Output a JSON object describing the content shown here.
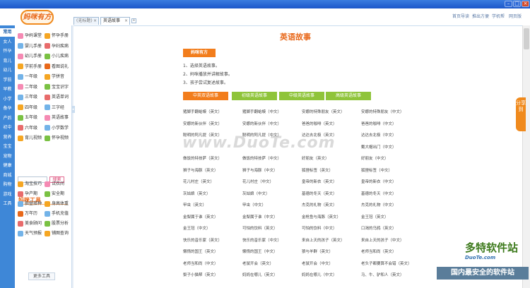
{
  "titlebar": {
    "min": "–",
    "max": "□",
    "close": "×"
  },
  "header": {
    "logo": "妈咪有方",
    "toplinks": [
      "首页导读",
      "推出方便",
      "学机帮",
      "网页版"
    ],
    "tabs": [
      {
        "label": "(无标题)",
        "close": "×"
      },
      {
        "label": "英语故事",
        "close": "×"
      }
    ],
    "tab_add": "+"
  },
  "leftnav": [
    "常用",
    "女人",
    "怀孕",
    "育儿",
    "幼儿",
    "学前",
    "早教",
    "小学",
    "备孕",
    "产后",
    "初中",
    "营养",
    "宝宝",
    "宠物",
    "健康",
    "商城",
    "购物",
    "游戏",
    "工具"
  ],
  "sidebar": {
    "items": [
      {
        "label": "孕妈课堂",
        "color": "#f58ab3"
      },
      {
        "label": "怀孕手册",
        "color": "#f5a623"
      },
      {
        "label": "婴儿手册",
        "color": "#73b3e8"
      },
      {
        "label": "孕妇疾病",
        "color": "#e86b6b"
      },
      {
        "label": "幼儿手册",
        "color": "#f58ab3"
      },
      {
        "label": "小儿疾病",
        "color": "#7ac143"
      },
      {
        "label": "学前手册",
        "color": "#f5a623"
      },
      {
        "label": "看图说礼",
        "color": "#e8681a"
      },
      {
        "label": "一年级",
        "color": "#73b3e8"
      },
      {
        "label": "学拼音",
        "color": "#f5a623"
      },
      {
        "label": "二年级",
        "color": "#f58ab3"
      },
      {
        "label": "宝宝识字",
        "color": "#7ac143"
      },
      {
        "label": "三年级",
        "color": "#73b3e8"
      },
      {
        "label": "英语单词",
        "color": "#e86b6b"
      },
      {
        "label": "四年级",
        "color": "#f5a623"
      },
      {
        "label": "三字经",
        "color": "#73b3e8"
      },
      {
        "label": "五年级",
        "color": "#7ac143"
      },
      {
        "label": "英语故事",
        "color": "#f58ab3"
      },
      {
        "label": "六年级",
        "color": "#e86b6b"
      },
      {
        "label": "小学数学",
        "color": "#73b3e8"
      },
      {
        "label": "育儿视频",
        "color": "#f5a623"
      },
      {
        "label": "怀孕视频",
        "color": "#7ac143"
      }
    ],
    "search_placeholder": "",
    "search_button": "搜索",
    "tools_title": "妈咪工具",
    "tools": [
      {
        "label": "淘宝技巧",
        "color": "#f5a623"
      },
      {
        "label": "试衣间",
        "color": "#f58ab3"
      },
      {
        "label": "孕产期",
        "color": "#e86b6b"
      },
      {
        "label": "安全期",
        "color": "#7ac143"
      },
      {
        "label": "胎昼接种",
        "color": "#73b3e8"
      },
      {
        "label": "身高体重",
        "color": "#f5a623"
      },
      {
        "label": "万年历",
        "color": "#e8681a"
      },
      {
        "label": "手机充值",
        "color": "#73b3e8"
      },
      {
        "label": "美食顾问",
        "color": "#e86b6b"
      },
      {
        "label": "股票分析",
        "color": "#7ac143"
      },
      {
        "label": "天气预报",
        "color": "#73b3e8"
      },
      {
        "label": "铺图查询",
        "color": "#f5a623"
      }
    ],
    "more_tools": "更多工具"
  },
  "main": {
    "title": "英语故事",
    "badge": "妈咪有方",
    "steps": [
      "1、选择英语故事。",
      "2、妈咪播放并讲解故事。",
      "3、孩子尝试复述故事。"
    ],
    "categories": [
      {
        "label": "中英双语故事",
        "color": "#f27d1c"
      },
      {
        "label": "初级英语故事",
        "color": "#8fc43a"
      },
      {
        "label": "中级英语故事",
        "color": "#8fc43a"
      },
      {
        "label": "高级英语故事",
        "color": "#8fc43a"
      }
    ],
    "stories": [
      [
        "猪脚手翻蛤蟆（英文）",
        "猪脚手翻蛤蟆（中文）",
        "安娜的特殊朋友（英文）",
        "安娜的特殊朋友（中文）"
      ],
      [
        "安娜的新伙伴（英文）",
        "安娜的新伙伴（中文）",
        "爸爸的咖啡（英文）",
        "爸爸的咖啡（中文）"
      ],
      [
        "聪明的阿凡提（英文）",
        "聪明的阿凡提（中文）",
        "达达去北极（英文）",
        "达达去北极（中文）"
      ],
      [
        "",
        "",
        "",
        "戴大帽出门（中文）"
      ],
      [
        "做饭的特技萨（英文）",
        "做饭的特技萨（中文）",
        "好朋友（英文）",
        "好朋友（中文）"
      ],
      [
        "狮子与海豚（英文）",
        "狮子与海豚（中文）",
        "狐狸标签（英文）",
        "狐狸标签（中文）"
      ],
      [
        "花儿村庄（英文）",
        "花儿村庄（中文）",
        "皇帝的新衣（英文）",
        "皇帝的新衣（中文）"
      ],
      [
        "灰姑娘（英文）",
        "灰姑娘（中文）",
        "基德的冬天（英文）",
        "基德的冬天（中文）"
      ],
      [
        "甲虫（英文）",
        "甲虫（中文）",
        "杰克的礼物（英文）",
        "杰克的礼物（中文）"
      ],
      [
        "金梨属于谁（英文）",
        "金梨属于谁（中文）",
        "金枪鱼与海豚（英文）",
        "金王冠（英文）"
      ],
      [
        "金王冠（中文）",
        "可怕的饮料（英文）",
        "可怕的饮料（中文）",
        "口渴的乌鸦（英文）"
      ],
      [
        "快乐的音乐家（英文）",
        "快乐的音乐家（中文）",
        "来自上天的孩子（英文）",
        "来自上天的孩子（中文）"
      ],
      [
        "懒惰的国王（英文）",
        "懒惰的国王（中文）",
        "狼与羊群（英文）",
        "老师当和尚（英文）"
      ],
      [
        "老师当和尚（中文）",
        "老鼠开会（英文）",
        "老鼠开会（中文）",
        "老头子都要算不会错（英文）"
      ],
      [
        "梨子小猫帮（英文）",
        "妈妈在哪儿（英文）",
        "妈妈在哪儿（中文）",
        "马、牛、驴和人（英文）"
      ]
    ]
  },
  "share": "分享到",
  "watermarks": {
    "center": "www.DuoTe.com",
    "brand": "多特软件站",
    "brand_sub": "DuoTe.com",
    "footer": "国内最安全的软件站"
  }
}
